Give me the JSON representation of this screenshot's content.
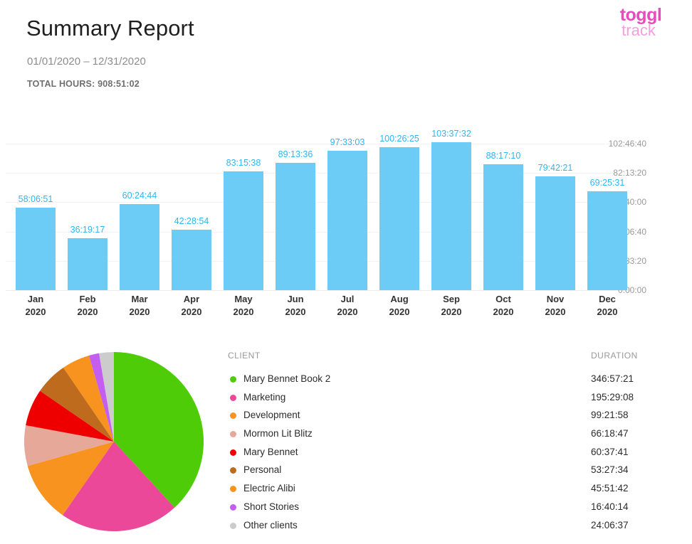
{
  "header": {
    "title": "Summary Report",
    "date_range": "01/01/2020 – 12/31/2020",
    "total_hours": "TOTAL HOURS: 908:51:02"
  },
  "logo": {
    "line1": "toggl",
    "line2": "track",
    "color_primary": "#e74bbd",
    "color_secondary": "#f2a0dd"
  },
  "chart_data": [
    {
      "type": "bar",
      "title": "",
      "xlabel": "",
      "ylabel": "",
      "grid": true,
      "bar_color": "#6dccf5",
      "label_color": "#2eb6f2",
      "categories": [
        "Jan\n2020",
        "Feb\n2020",
        "Mar\n2020",
        "Apr\n2020",
        "May\n2020",
        "Jun\n2020",
        "Jul\n2020",
        "Aug\n2020",
        "Sep\n2020",
        "Oct\n2020",
        "Nov\n2020",
        "Dec\n2020"
      ],
      "month_labels": [
        "Jan",
        "Feb",
        "Mar",
        "Apr",
        "May",
        "Jun",
        "Jul",
        "Aug",
        "Sep",
        "Oct",
        "Nov",
        "Dec"
      ],
      "year_labels": [
        "2020",
        "2020",
        "2020",
        "2020",
        "2020",
        "2020",
        "2020",
        "2020",
        "2020",
        "2020",
        "2020",
        "2020"
      ],
      "value_labels": [
        "58:06:51",
        "36:19:17",
        "60:24:44",
        "42:28:54",
        "83:15:38",
        "89:13:36",
        "97:33:03",
        "100:26:25",
        "103:37:32",
        "88:17:10",
        "79:42:21",
        "69:25:31"
      ],
      "values": [
        58.114,
        36.321,
        60.412,
        42.482,
        83.261,
        89.227,
        97.551,
        100.44,
        103.626,
        88.286,
        79.706,
        69.425
      ],
      "ytick_labels": [
        "102:46:40",
        "82:13:20",
        "61:40:00",
        "41:06:40",
        "20:33:20",
        "0:00:00"
      ],
      "ytick_values": [
        102.778,
        82.222,
        61.667,
        41.111,
        20.556,
        0
      ],
      "ylim": [
        0,
        102.778
      ]
    },
    {
      "type": "pie",
      "title": "",
      "legend_position": "right",
      "columns": [
        "CLIENT",
        "DURATION"
      ],
      "labels": [
        "Mary Bennet Book 2",
        "Marketing",
        "Development",
        "Mormon Lit Blitz",
        "Mary Bennet",
        "Personal",
        "Electric Alibi",
        "Short Stories",
        "Other clients"
      ],
      "duration_labels": [
        "346:57:21",
        "195:29:08",
        "99:21:58",
        "66:18:47",
        "60:37:41",
        "53:27:34",
        "45:51:42",
        "16:40:14",
        "24:06:37"
      ],
      "values": [
        346.956,
        195.486,
        99.366,
        66.313,
        60.628,
        53.459,
        45.862,
        16.671,
        24.11
      ],
      "colors": [
        "#4ecc08",
        "#ec4899",
        "#f7931e",
        "#e6a898",
        "#ee0000",
        "#bf6b1e",
        "#f7931e",
        "#c45ef0",
        "#cccccc"
      ]
    }
  ]
}
